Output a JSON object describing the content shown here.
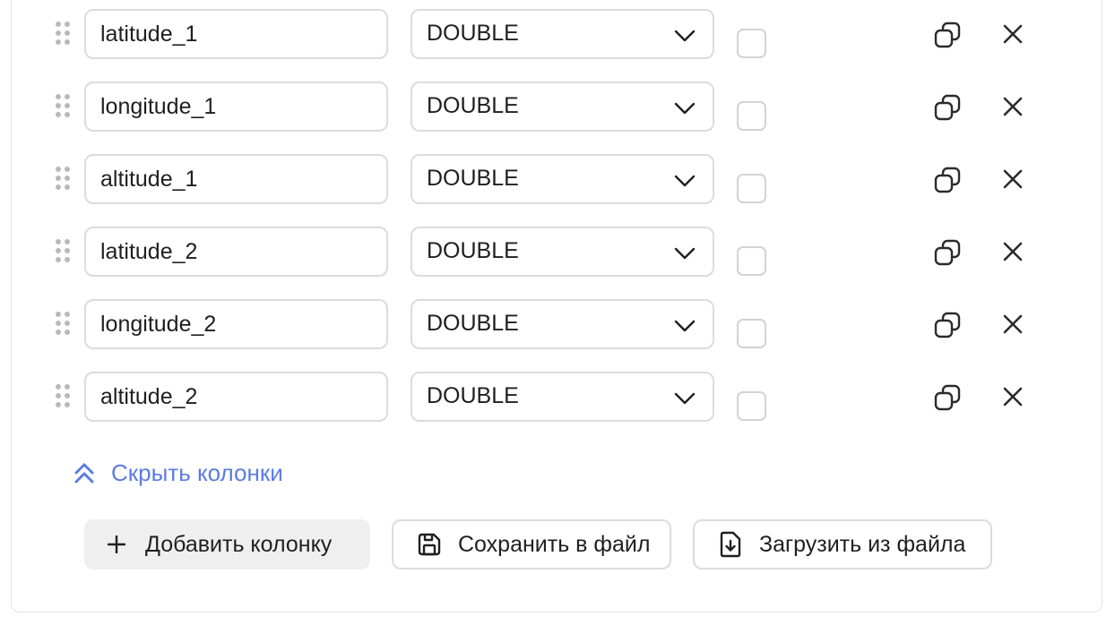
{
  "columns": [
    {
      "name": "latitude_1",
      "type": "DOUBLE",
      "checked": false
    },
    {
      "name": "longitude_1",
      "type": "DOUBLE",
      "checked": false
    },
    {
      "name": "altitude_1",
      "type": "DOUBLE",
      "checked": false
    },
    {
      "name": "latitude_2",
      "type": "DOUBLE",
      "checked": false
    },
    {
      "name": "longitude_2",
      "type": "DOUBLE",
      "checked": false
    },
    {
      "name": "altitude_2",
      "type": "DOUBLE",
      "checked": false
    }
  ],
  "hide_columns": {
    "label": "Скрыть колонки",
    "icon": "double-chevron-up-icon"
  },
  "actions": {
    "add_column": {
      "label": "Добавить колонку",
      "icon": "plus-icon"
    },
    "save_to_file": {
      "label": "Сохранить в файл",
      "icon": "save-icon"
    },
    "load_from_file": {
      "label": "Загрузить из файла",
      "icon": "file-download-icon"
    }
  },
  "colors": {
    "link": "#5b7ce0",
    "border": "#dcdcdc",
    "add_button_bg": "#efefef"
  }
}
